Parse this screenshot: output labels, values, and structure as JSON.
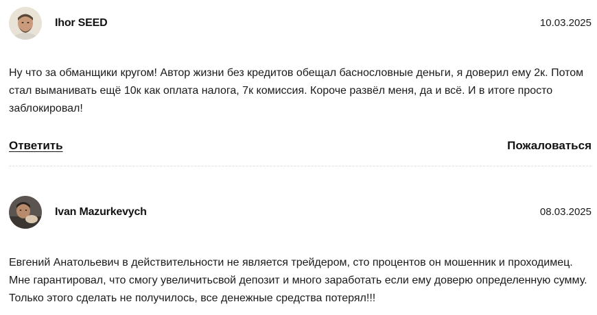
{
  "reviews": [
    {
      "author": "Ihor SEED",
      "date": "10.03.2025",
      "text": "Ну что за обманщики кругом! Автор жизни без кредитов обещал баснословные деньги, я доверил ему 2к. Потом стал выманивать ещё 10к как оплата налога, 7к комиссия. Короче развёл меня, да и всё. И в итоге просто заблокировал!",
      "reply_label": "Ответить",
      "report_label": "Пожаловаться"
    },
    {
      "author": "Ivan Mazurkevych",
      "date": "08.03.2025",
      "text": "Евгений Анатольевич в действительности не является трейдером, сто процентов он мошенник и проходимец. Мне гарантировал, что смогу увеличитьсвой депозит и много заработать если ему доверю определенную сумму. Только этого сделать не получилось, все денежные средства потерял!!!"
    }
  ]
}
